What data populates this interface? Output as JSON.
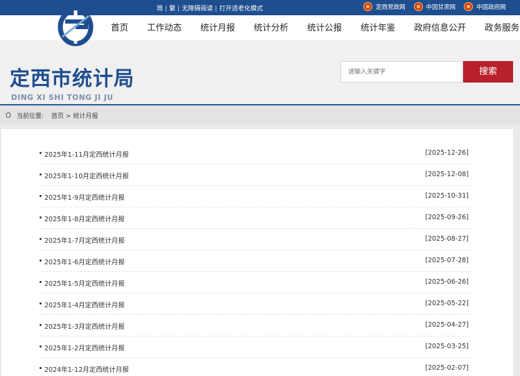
{
  "topbar": {
    "accessibility": [
      "简",
      "繁",
      "无障碍阅读",
      "打开适老化模式"
    ],
    "external_links": [
      "定西党政网",
      "中国甘肃网",
      "中国政府网"
    ]
  },
  "nav": {
    "items": [
      "首页",
      "工作动态",
      "统计月报",
      "统计分析",
      "统计公报",
      "统计年鉴",
      "政府信息公开",
      "政务服务"
    ]
  },
  "banner": {
    "site_title": "定西市统计局",
    "site_pinyin": "DING XI SHI TONG JI JU"
  },
  "search": {
    "placeholder": "请输入关键字",
    "button_label": "搜索"
  },
  "breadcrumb": {
    "label": "当前位置:",
    "home": "首页",
    "separator": ">",
    "current": "统计月报"
  },
  "list": [
    {
      "title": "2025年1-11月定西统计月报",
      "date": "[2025-12-26]"
    },
    {
      "title": "2025年1-10月定西统计月报",
      "date": "[2025-12-08]"
    },
    {
      "title": "2025年1-9月定西统计月报",
      "date": "[2025-10-31]"
    },
    {
      "title": "2025年1-8月定西统计月报",
      "date": "[2025-09-26]"
    },
    {
      "title": "2025年1-7月定西统计月报",
      "date": "[2025-08-27]"
    },
    {
      "title": "2025年1-6月定西统计月报",
      "date": "[2025-07-28]"
    },
    {
      "title": "2025年1-5月定西统计月报",
      "date": "[2025-06-26]"
    },
    {
      "title": "2025年1-4月定西统计月报",
      "date": "[2025-05-22]"
    },
    {
      "title": "2025年1-3月定西统计月报",
      "date": "[2025-04-27]"
    },
    {
      "title": "2025年1-2月定西统计月报",
      "date": "[2025-03-25]"
    },
    {
      "title": "2024年1-12月定西统计月报",
      "date": "[2025-02-07]"
    }
  ],
  "colors": {
    "brand_blue": "#1f4e8f",
    "search_red": "#b8202a",
    "emblem_red": "#d63a2a",
    "emblem_gold": "#f5c242"
  },
  "icons": {
    "logo": "logo-icon",
    "emblem": "national-emblem-icon",
    "home": "home-icon"
  }
}
